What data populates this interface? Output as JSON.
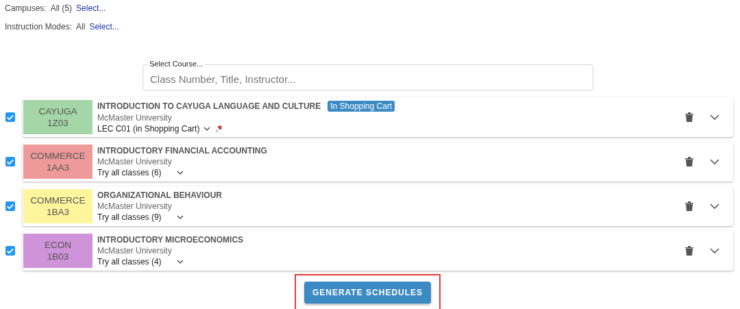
{
  "filters": [
    {
      "label": "Campuses:",
      "value": "All (5)",
      "link": "Select..."
    },
    {
      "label": "Instruction Modes:",
      "value": "All",
      "link": "Select..."
    }
  ],
  "search": {
    "label": "Select Course...",
    "placeholder": "Class Number, Title, Instructor..."
  },
  "courses": [
    {
      "checked": true,
      "subject": "CAYUGA",
      "code": "1Z03",
      "color": "#a5d6a7",
      "title": "INTRODUCTION TO CAYUGA LANGUAGE AND CULTURE",
      "badge": "In Shopping Cart",
      "school": "McMaster University",
      "classes": "LEC C01 (in Shopping Cart)",
      "pinned": true
    },
    {
      "checked": true,
      "subject": "COMMERCE",
      "code": "1AA3",
      "color": "#ef9a9a",
      "title": "INTRODUCTORY FINANCIAL ACCOUNTING",
      "school": "McMaster University",
      "classes": "Try all classes (6)",
      "pinned": false
    },
    {
      "checked": true,
      "subject": "COMMERCE",
      "code": "1BA3",
      "color": "#fff59d",
      "title": "ORGANIZATIONAL BEHAVIOUR",
      "school": "McMaster University",
      "classes": "Try all classes (9)",
      "pinned": false
    },
    {
      "checked": true,
      "subject": "ECON",
      "code": "1B03",
      "color": "#ce93d8",
      "title": "INTRODUCTORY MICROECONOMICS",
      "school": "McMaster University",
      "classes": "Try all classes (4)",
      "pinned": false
    }
  ],
  "button": {
    "label": "GENERATE SCHEDULES",
    "highlighted": true
  }
}
